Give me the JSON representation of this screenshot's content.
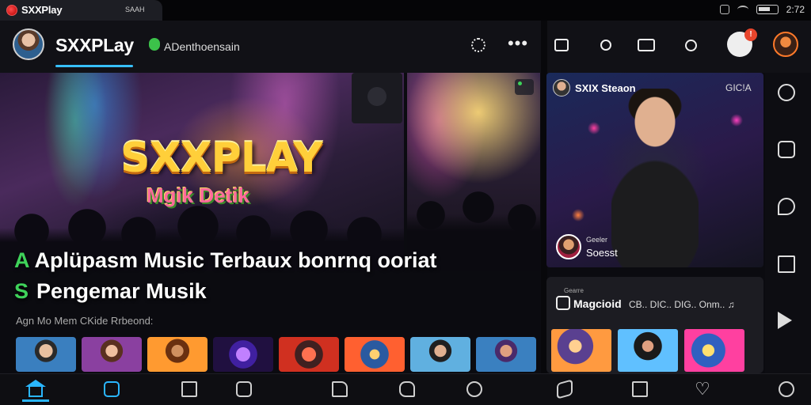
{
  "status_bar": {
    "app_title": "SXXPlay",
    "app_mini": "SAAH",
    "time": "2:72"
  },
  "header": {
    "brand": "SXXPLay",
    "tagline": "ADenthoensain",
    "notification_count": "!"
  },
  "hero": {
    "logo_text": "SXXPLAY",
    "logo_sub": "Mgik Detik",
    "title_prefix": "A",
    "title_line1": "Aplüpasm Music Terbaux bonrnq ooriat",
    "title2_prefix": "S",
    "title_line2": "Pengemar Musik",
    "subtitle": "Agn Mo Mem CKide Rrbeond:"
  },
  "right_panel": {
    "channel_name": "SXIX Steaon",
    "channel_code": "GIC!A",
    "mini_label": "Geeler",
    "mini_name": "Soesst"
  },
  "magazine": {
    "small_label": "Gearre",
    "title": "Magcioid",
    "meta": "CB.. DIC.. DIG.. Onm.. ♫"
  },
  "colors": {
    "accent": "#2ab6ff",
    "brand_green": "#3fd25a",
    "notification": "#e8452c",
    "logo_gold": "#ffcf3a"
  },
  "icons": {
    "top": [
      "gear-icon",
      "more-icon",
      "share-icon",
      "user-icon",
      "camera-icon",
      "search-icon",
      "notification-icon",
      "profile-icon"
    ],
    "rail": [
      "cloud-icon",
      "edit-icon",
      "shield-icon",
      "window-icon",
      "play-icon"
    ],
    "bottom_nav": [
      "home-icon",
      "library-icon",
      "bookmark-icon",
      "image-icon",
      "folder-icon",
      "chat-icon",
      "explore-icon",
      "cube-icon",
      "list-icon",
      "heart-icon",
      "globe-icon"
    ]
  }
}
